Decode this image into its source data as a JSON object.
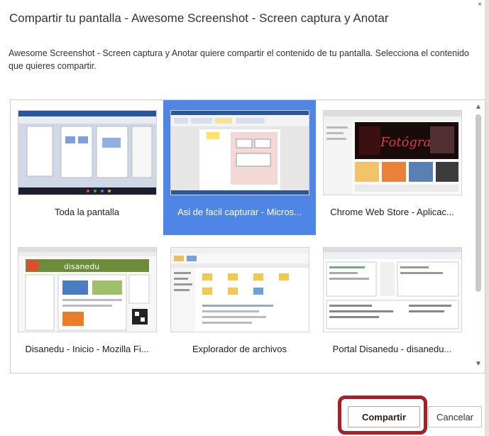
{
  "dialog": {
    "title": "Compartir tu pantalla - Awesome Screenshot - Screen captura y Anotar",
    "description": "Awesome Screenshot - Screen captura y Anotar  quiere compartir el contenido de tu pantalla. Selecciona el contenido que quieres compartir.",
    "close_glyph": "×"
  },
  "sources": [
    {
      "label": "Toda la pantalla",
      "selected": false
    },
    {
      "label": "Asi de facil capturar - Micros...",
      "selected": true
    },
    {
      "label": "Chrome Web Store - Aplicac...",
      "selected": false
    },
    {
      "label": "Disanedu - Inicio - Mozilla Fi...",
      "selected": false
    },
    {
      "label": "Explorador de archivos",
      "selected": false
    },
    {
      "label": "Portal Disanedu - disanedu...",
      "selected": false
    }
  ],
  "thumbnail_text": {
    "store_title": "Fotógrafo",
    "disanedu_logo": "disanedu"
  },
  "scrollbar": {
    "up_glyph": "▲",
    "down_glyph": "▼"
  },
  "buttons": {
    "share": "Compartir",
    "cancel": "Cancelar"
  },
  "colors": {
    "selection": "#4f86e6",
    "highlight": "#a81f2a",
    "background": "#f1dcdc"
  }
}
